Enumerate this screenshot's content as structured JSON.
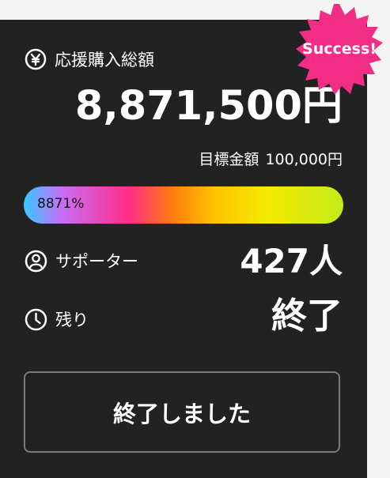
{
  "funding": {
    "label": "応援購入総額",
    "amount": "8,871,500円",
    "target_label": "目標金額",
    "target_value": "100,000円",
    "progress_text": "8871%",
    "progress_percent": 8871
  },
  "supporters": {
    "label": "サポーター",
    "value": "427人"
  },
  "remaining": {
    "label": "残り",
    "value": "終了"
  },
  "action": {
    "label": "終了しました"
  },
  "badge": {
    "text": "Success!"
  },
  "colors": {
    "panel_bg": "#222222",
    "badge": "#f22d86",
    "button_border": "#7a7a7a"
  }
}
